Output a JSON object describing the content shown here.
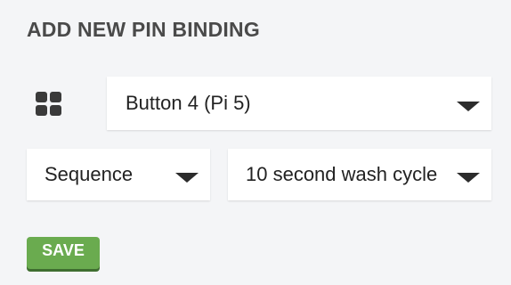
{
  "header": {
    "title": "ADD NEW PIN BINDING"
  },
  "form": {
    "grid_icon": "grid-icon",
    "button_select": {
      "value": "Button 4 (Pi 5)"
    },
    "type_select": {
      "value": "Sequence"
    },
    "sequence_select": {
      "value": "10 second wash cycle"
    },
    "save_label": "SAVE"
  },
  "colors": {
    "background": "#f4f5f7",
    "title": "#4a4a4a",
    "save_button": "#6aab4f",
    "save_shadow": "#3f6e30",
    "icon": "#3a3a3a"
  }
}
